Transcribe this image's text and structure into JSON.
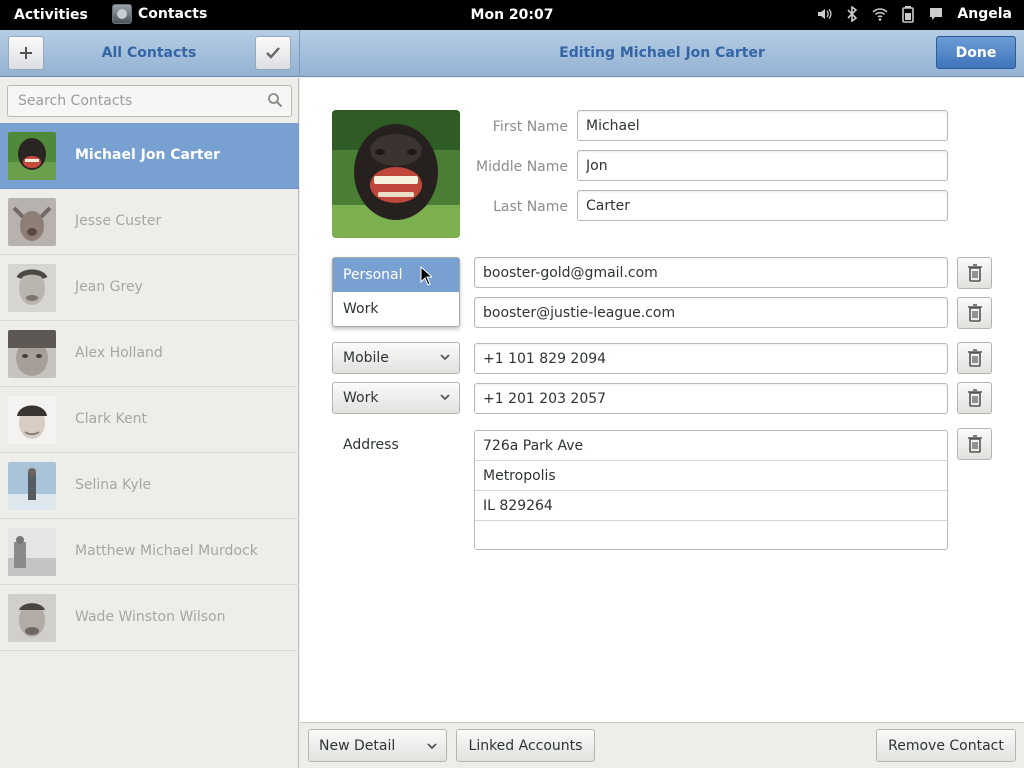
{
  "topbar": {
    "activities": "Activities",
    "app_name": "Contacts",
    "clock": "Mon 20:07",
    "user": "Angela"
  },
  "header": {
    "add_icon": "plus-icon",
    "title_left": "All Contacts",
    "select_icon": "check-icon",
    "title_right": "Editing Michael Jon Carter",
    "done_label": "Done"
  },
  "sidebar": {
    "search_placeholder": "Search Contacts",
    "contacts": [
      {
        "name": "Michael Jon Carter",
        "selected": true
      },
      {
        "name": "Jesse Custer",
        "selected": false
      },
      {
        "name": "Jean Grey",
        "selected": false
      },
      {
        "name": "Alex Holland",
        "selected": false
      },
      {
        "name": "Clark Kent",
        "selected": false
      },
      {
        "name": "Selina Kyle",
        "selected": false
      },
      {
        "name": "Matthew Michael Murdock",
        "selected": false
      },
      {
        "name": "Wade Winston Wilson",
        "selected": false
      }
    ]
  },
  "editor": {
    "first_name_label": "First Name",
    "first_name": "Michael",
    "middle_name_label": "Middle Name",
    "middle_name": "Jon",
    "last_name_label": "Last Name",
    "last_name": "Carter",
    "email_type_popup": {
      "options": [
        "Personal",
        "Work"
      ],
      "active": "Personal"
    },
    "emails": [
      "booster-gold@gmail.com",
      "booster@justie-league.com"
    ],
    "phones": [
      {
        "type": "Mobile",
        "number": "+1 101 829 2094"
      },
      {
        "type": "Work",
        "number": "+1 201 203 2057"
      }
    ],
    "address_label": "Address",
    "address_lines": [
      "726a Park Ave",
      "Metropolis",
      "IL 829264",
      ""
    ]
  },
  "bottombar": {
    "new_detail": "New Detail",
    "linked_accounts": "Linked Accounts",
    "remove_contact": "Remove Contact"
  },
  "colors": {
    "accent": "#78a1d2",
    "header_text": "#3465a4",
    "done_button": "#4a7fc2"
  }
}
